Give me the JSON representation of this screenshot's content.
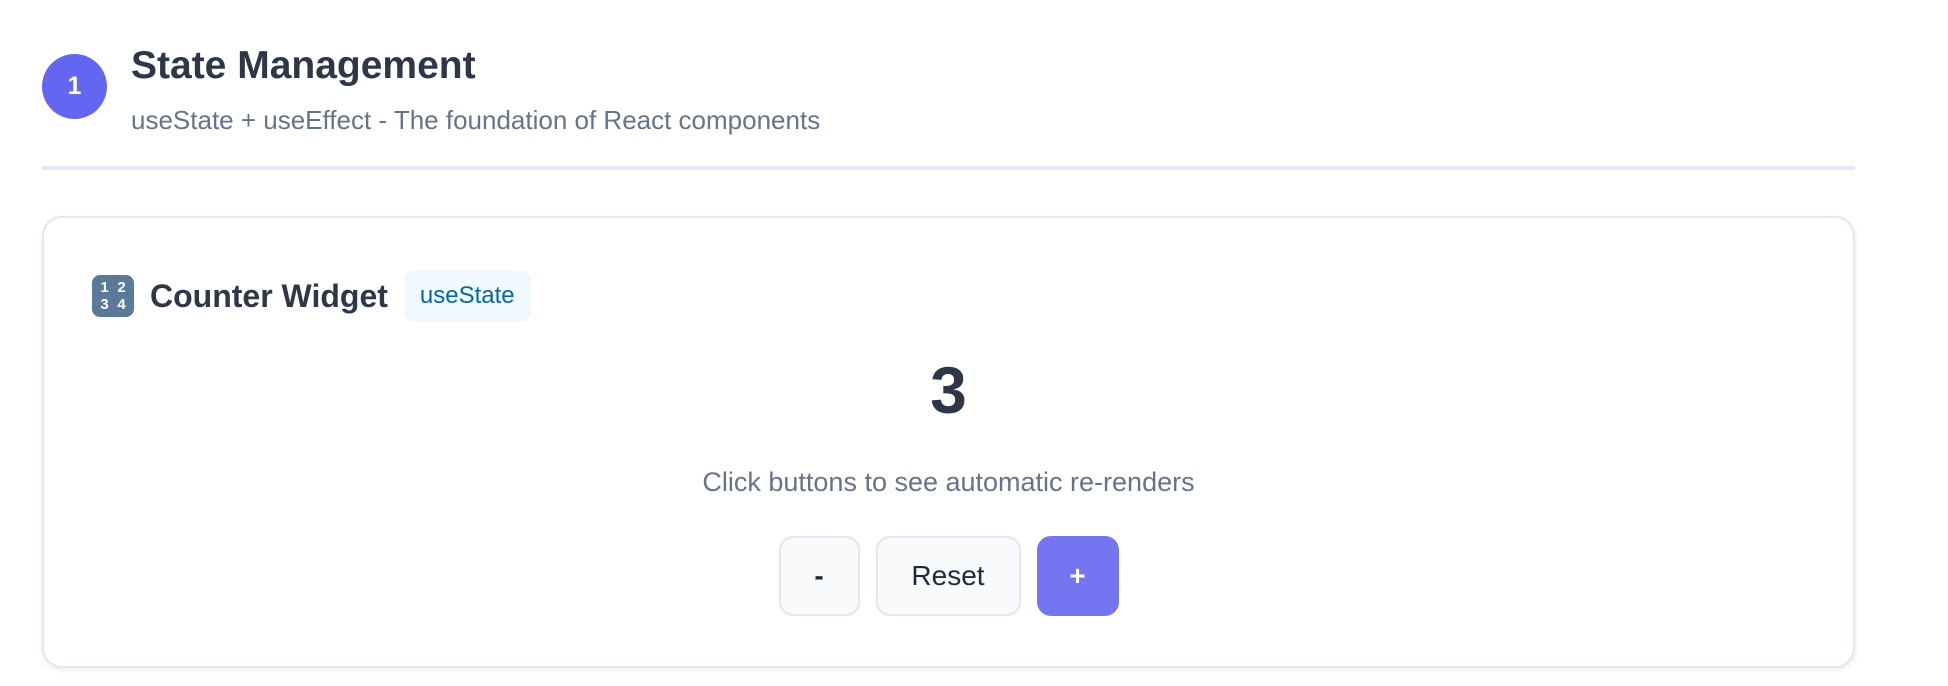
{
  "section": {
    "step_number": "1",
    "title": "State Management",
    "subtitle": "useState + useEffect - The foundation of React components"
  },
  "widget": {
    "icon": "input-numbers-icon",
    "icon_digits": [
      "1",
      "2",
      "3",
      "4"
    ],
    "title": "Counter Widget",
    "hook_tag": "useState",
    "count": "3",
    "hint": "Click buttons to see automatic re-renders",
    "buttons": {
      "decrement": "-",
      "reset": "Reset",
      "increment": "+"
    }
  },
  "colors": {
    "accent": "#6366f1",
    "increment_button": "#7476f1",
    "tag_background": "#f0f9ff",
    "tag_text": "#0369a1",
    "muted_text": "#64748b",
    "heading_text": "#2d3748"
  }
}
